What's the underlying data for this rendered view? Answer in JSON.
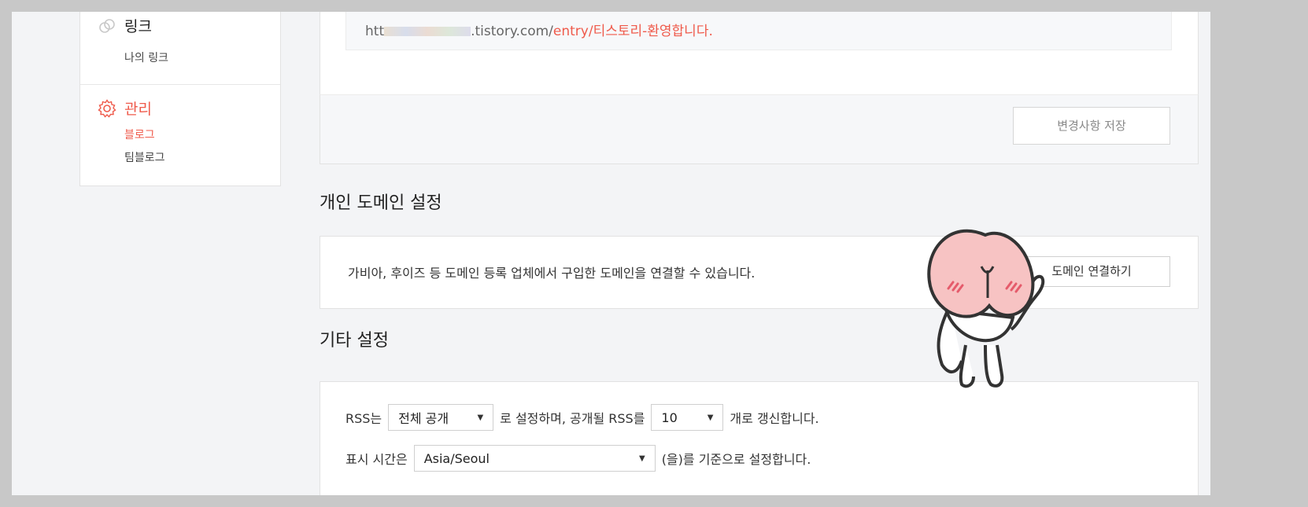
{
  "sidebar": {
    "link_section": {
      "title": "링크",
      "items": [
        {
          "label": "나의 링크"
        }
      ]
    },
    "manage_section": {
      "title": "관리",
      "items": [
        {
          "label": "블로그"
        },
        {
          "label": "팀블로그"
        }
      ]
    }
  },
  "url_panel": {
    "url_prefix": "htt",
    "url_domain": ".tistory.com/",
    "url_path": "entry/티스토리-환영합니다.",
    "save_button": "변경사항 저장"
  },
  "domain_section": {
    "title": "개인 도메인 설정",
    "description": "가비아, 후이즈 등 도메인 등록 업체에서 구입한 도메인을 연결할 수 있습니다.",
    "connect_button": "도메인 연결하기"
  },
  "etc_section": {
    "title": "기타 설정",
    "rss": {
      "label_before": "RSS는",
      "visibility_value": "전체 공개",
      "label_middle": "로 설정하며, 공개될 RSS를",
      "count_value": "10",
      "label_after": "개로 갱신합니다."
    },
    "timezone": {
      "label_before": "표시 시간은",
      "value": "Asia/Seoul",
      "label_after": "(을)를 기준으로 설정합니다."
    }
  },
  "colors": {
    "accent": "#ef5a4b",
    "background": "#f3f4f6"
  },
  "icons": {
    "link": "link-icon",
    "settings": "gear-icon",
    "caret": "caret-down-icon"
  }
}
